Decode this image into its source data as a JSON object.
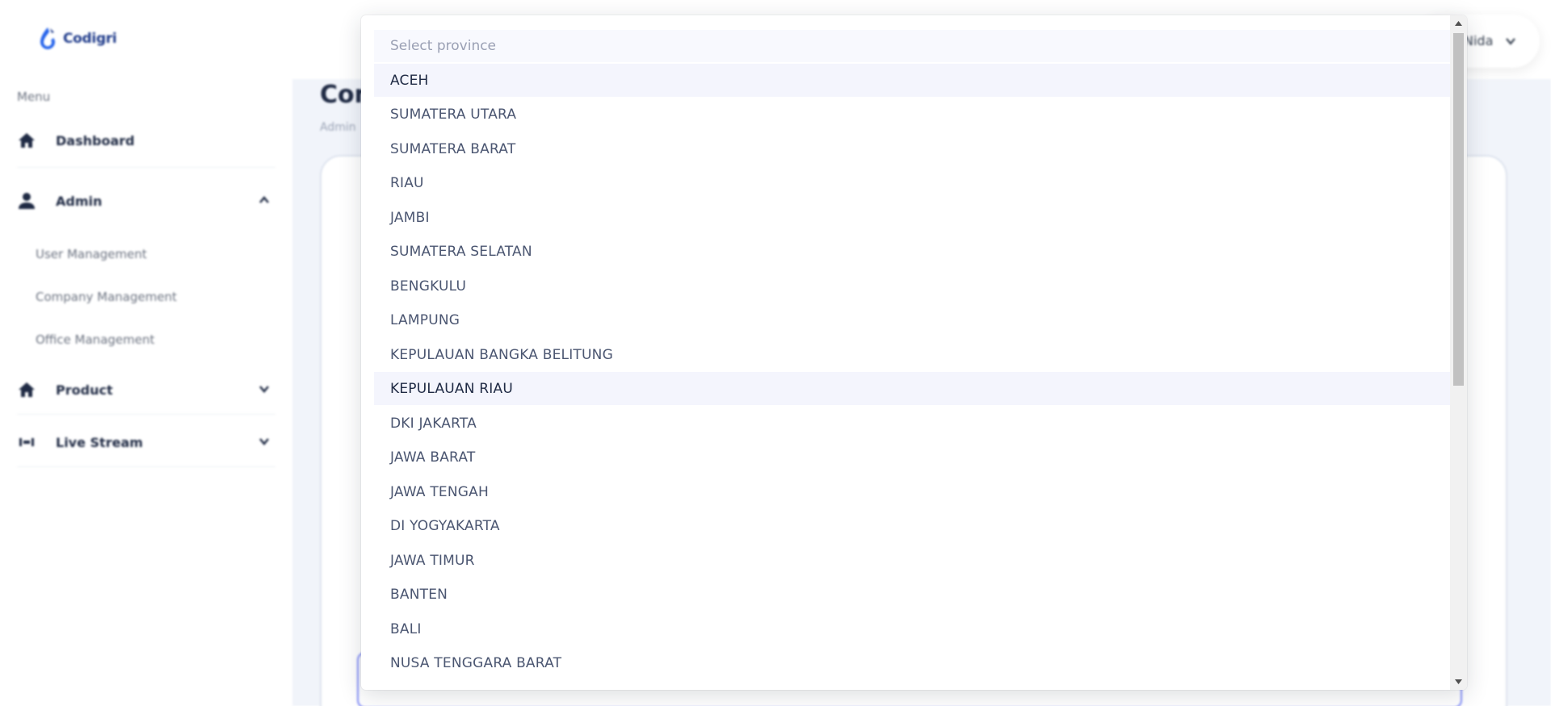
{
  "app": {
    "logo_text": "Codigri"
  },
  "sidebar": {
    "menu_title": "Menu",
    "items": [
      {
        "label": "Dashboard",
        "icon": "home-icon"
      },
      {
        "label": "Admin",
        "icon": "user-icon",
        "expanded": true
      },
      {
        "label": "Product",
        "icon": "home-icon",
        "expanded": false
      },
      {
        "label": "Live Stream",
        "icon": "broadcast-icon",
        "expanded": false
      }
    ],
    "admin_sub_items": [
      "User Management",
      "Company Management",
      "Office Management"
    ]
  },
  "header": {
    "user_name": "Nida"
  },
  "main": {
    "page_title": "Company",
    "breadcrumb": "Admin"
  },
  "dropdown": {
    "placeholder": "Select province",
    "options": [
      "ACEH",
      "SUMATERA UTARA",
      "SUMATERA BARAT",
      "RIAU",
      "JAMBI",
      "SUMATERA SELATAN",
      "BENGKULU",
      "LAMPUNG",
      "KEPULAUAN BANGKA BELITUNG",
      "KEPULAUAN RIAU",
      "DKI JAKARTA",
      "JAWA BARAT",
      "JAWA TENGAH",
      "DI YOGYAKARTA",
      "JAWA TIMUR",
      "BANTEN",
      "BALI",
      "NUSA TENGGARA BARAT"
    ],
    "highlighted": [
      "ACEH",
      "KEPULAUAN RIAU"
    ]
  },
  "colors": {
    "brand": "#1e3a8a",
    "logo_accent": "#2563eb",
    "focus_border": "#818cf8",
    "main_bg": "#f1f4fa"
  }
}
